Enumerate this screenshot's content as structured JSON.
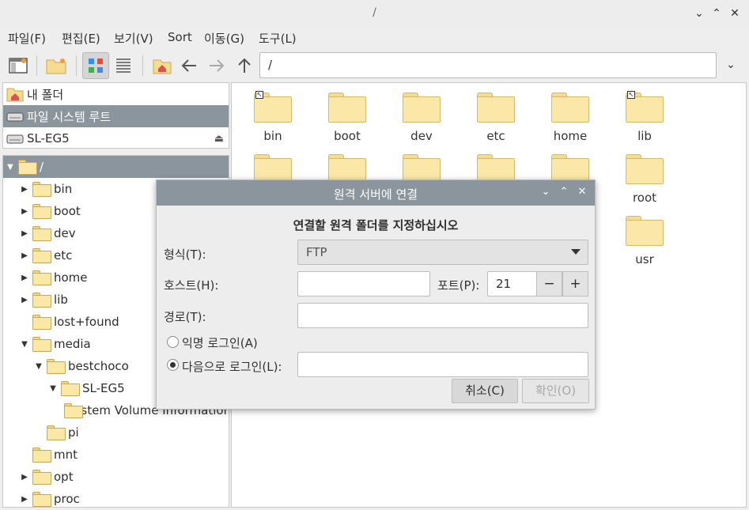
{
  "window": {
    "title": "/"
  },
  "menu": [
    "파일(F)",
    "편집(E)",
    "보기(V)",
    "Sort",
    "이동(G)",
    "도구(L)"
  ],
  "toolbar": {
    "path": "/"
  },
  "places": [
    {
      "label": "내 폴더"
    },
    {
      "label": "파일 시스템 루트"
    },
    {
      "label": "SL-EG5"
    }
  ],
  "tree": [
    {
      "label": "/"
    },
    {
      "label": "bin"
    },
    {
      "label": "boot"
    },
    {
      "label": "dev"
    },
    {
      "label": "etc"
    },
    {
      "label": "home"
    },
    {
      "label": "lib"
    },
    {
      "label": "lost+found"
    },
    {
      "label": "media"
    },
    {
      "label": "bestchoco"
    },
    {
      "label": "SL-EG5"
    },
    {
      "label": "System Volume Information"
    },
    {
      "label": "pi"
    },
    {
      "label": "mnt"
    },
    {
      "label": "opt"
    },
    {
      "label": "proc"
    }
  ],
  "files": [
    {
      "name": "bin"
    },
    {
      "name": "boot"
    },
    {
      "name": "dev"
    },
    {
      "name": "etc"
    },
    {
      "name": "home"
    },
    {
      "name": "lib"
    },
    {
      "name": ""
    },
    {
      "name": ""
    },
    {
      "name": ""
    },
    {
      "name": ""
    },
    {
      "name": ""
    },
    {
      "name": "root"
    },
    {
      "name": "usr"
    }
  ],
  "dialog": {
    "title": "원격 서버에 연결",
    "header": "연결할 원격 폴더를 지정하십시오",
    "type_label": "형식(T):",
    "type_value": "FTP",
    "host_label": "호스트(H):",
    "host_value": "",
    "port_label": "포트(P):",
    "port_value": "21",
    "path_label": "경로(T):",
    "path_value": "",
    "anon_label": "익명 로그인(A)",
    "user_label": "다음으로 로그인(L):",
    "user_value": "",
    "cancel": "취소(C)",
    "ok": "확인(O)"
  },
  "colors": {
    "selection": "#8b959d",
    "folder": "#fbe8a8"
  }
}
